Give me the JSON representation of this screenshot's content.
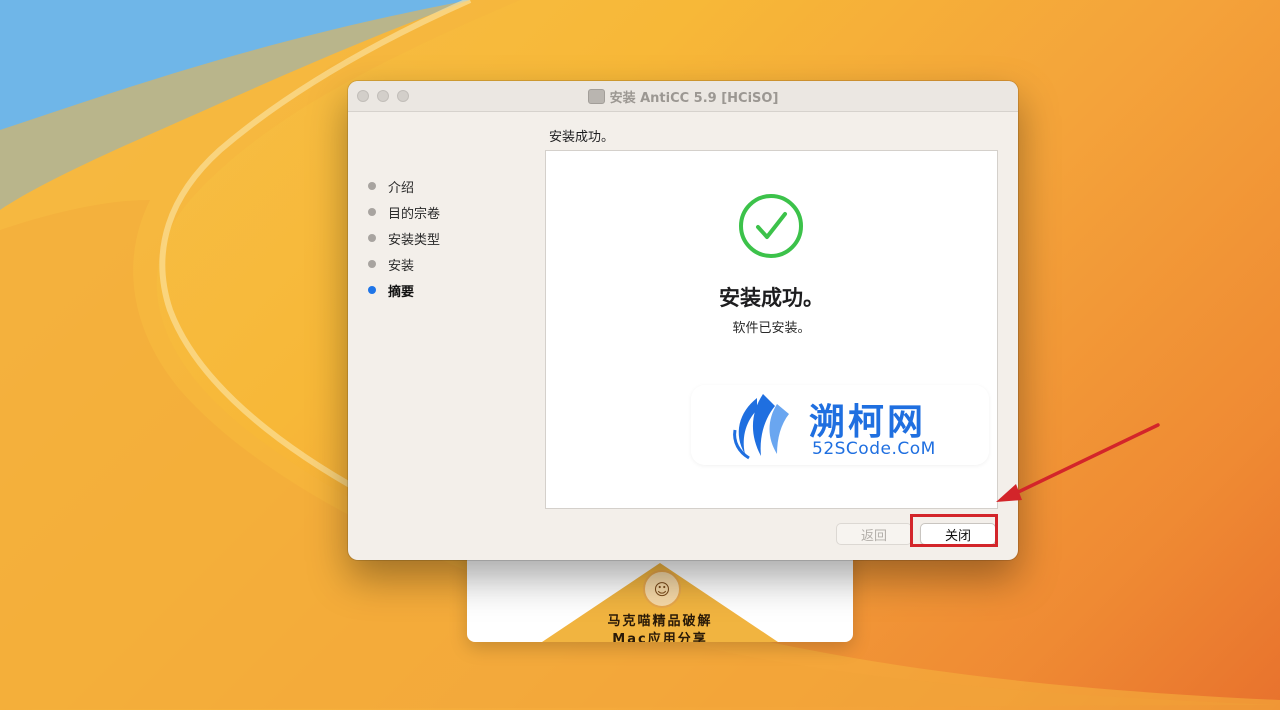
{
  "window": {
    "title": "安装 AntiCC 5.9 [HCiSO]",
    "heading": "安装成功。"
  },
  "sidebar": {
    "steps": [
      {
        "label": "介绍",
        "active": false
      },
      {
        "label": "目的宗卷",
        "active": false
      },
      {
        "label": "安装类型",
        "active": false
      },
      {
        "label": "安装",
        "active": false
      },
      {
        "label": "摘要",
        "active": true
      }
    ]
  },
  "content": {
    "success_title": "安装成功。",
    "success_subtitle": "软件已安装。"
  },
  "watermark": {
    "title": "溯柯网",
    "subtitle": "52SCode.CoM"
  },
  "buttons": {
    "back_label": "返回",
    "close_label": "关闭"
  },
  "background_window": {
    "line1": "马克喵精品破解",
    "line2": "Mac应用分享"
  },
  "colors": {
    "success_green": "#3cc24a",
    "accent_blue": "#1f75e8",
    "highlight_red": "#d3252a"
  },
  "icons": {
    "success": "checkmark-circle-icon",
    "title": "disk-image-icon",
    "watermark": "wing-logo-icon"
  }
}
